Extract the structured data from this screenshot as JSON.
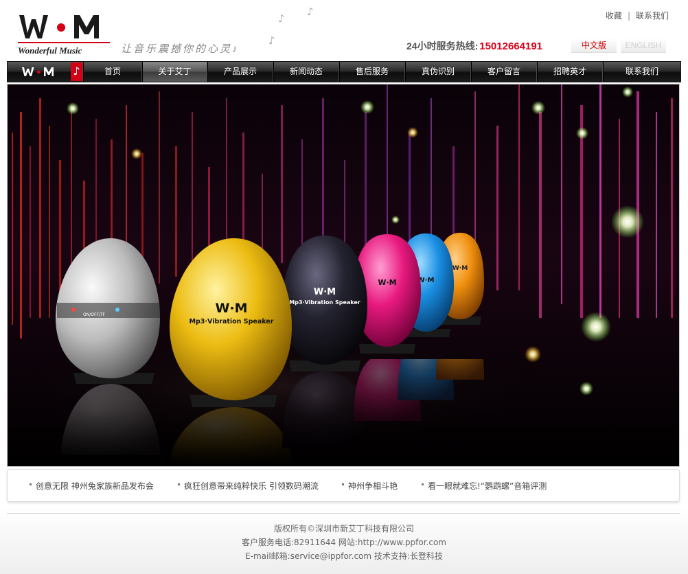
{
  "brand": {
    "logo_text": "W·M",
    "logo_script": "Wonderful Music",
    "slogan": "让音乐震撼你的心灵♪"
  },
  "top_links": {
    "favorite": "收藏",
    "separator": "|",
    "contact": "联系我们"
  },
  "hotline": {
    "label": "24小时服务热线:",
    "number": "15012664191"
  },
  "languages": {
    "chinese": "中文版",
    "english": "ENGLISH"
  },
  "nav": {
    "items": [
      {
        "label": "首页"
      },
      {
        "label": "关于艾丁",
        "active": true
      },
      {
        "label": "产品展示"
      },
      {
        "label": "新闻动态"
      },
      {
        "label": "售后服务"
      },
      {
        "label": "真伪识别"
      },
      {
        "label": "客户留言"
      },
      {
        "label": "招聘英才"
      },
      {
        "label": "联系我们"
      }
    ]
  },
  "banner": {
    "speaker_label": "Mp3·Vibration Speaker",
    "speaker_brand": "W·M",
    "control_label": "ON/OFF/TF",
    "colors": [
      "#c9c9c9",
      "#e8b80e",
      "#1d1c2a",
      "#e8197f",
      "#1a8fe3",
      "#f0900f"
    ]
  },
  "news": [
    "创意无限 神州兔家族新品发布会",
    "疯狂创意带来纯粹快乐 引领数码潮流",
    "神州争相斗艳",
    "看一眼就难忘!“鹦鹉螺”音箱评测"
  ],
  "footer": {
    "copyright": "版权所有©深圳市新艾丁科技有限公司",
    "service": "客户服务电话:82911644   网站:http://www.ppfor.com",
    "contact": "E-mail邮箱:service@ippfor.com   技术支持:长登科技"
  }
}
